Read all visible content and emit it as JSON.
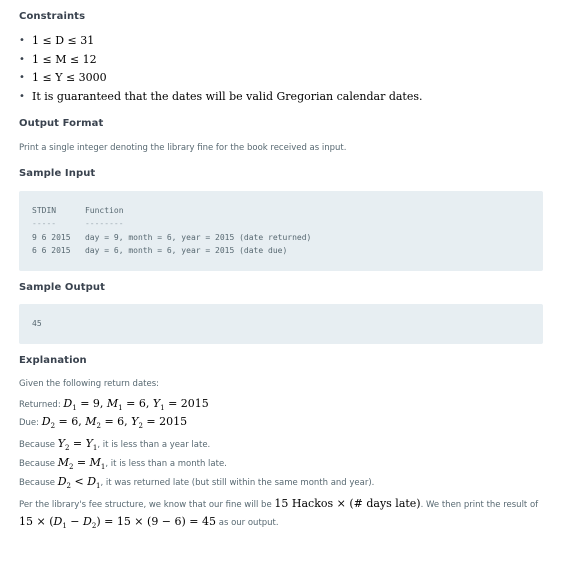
{
  "sections": {
    "constraints_heading": "Constraints",
    "output_format_heading": "Output Format",
    "sample_input_heading": "Sample Input",
    "sample_output_heading": "Sample Output",
    "explanation_heading": "Explanation"
  },
  "constraints": [
    "1 ≤ D ≤ 31",
    "1 ≤ M ≤ 12",
    "1 ≤ Y ≤ 3000",
    "It is guaranteed that the dates will be valid Gregorian calendar dates."
  ],
  "output_format_text": "Print a single integer denoting the library fine for the book received as input.",
  "sample_input": {
    "header": "STDIN      Function",
    "rule": "-----      --------",
    "row1": "9 6 2015   day = 9, month = 6, year = 2015 (date returned)",
    "row2": "6 6 2015   day = 6, month = 6, year = 2015 (date due)"
  },
  "sample_output": "45",
  "explanation": {
    "intro": "Given the following return dates:",
    "returned_label": "Returned: ",
    "due_label": "Due: ",
    "because1_label": "Because ",
    "because1_text": ", it is less than a year late.",
    "because2_label": "Because ",
    "because2_text": ", it is less than a month late.",
    "because3_label": "Because ",
    "because3_text": ", it was returned late (but still within the same month and year).",
    "fee_prefix": "Per the library's fee structure, we know that our fine will be ",
    "fee_math": "15 Hackos × (# days late)",
    "fee_suffix": ". We then print the result of",
    "result_suffix": " as our output."
  }
}
